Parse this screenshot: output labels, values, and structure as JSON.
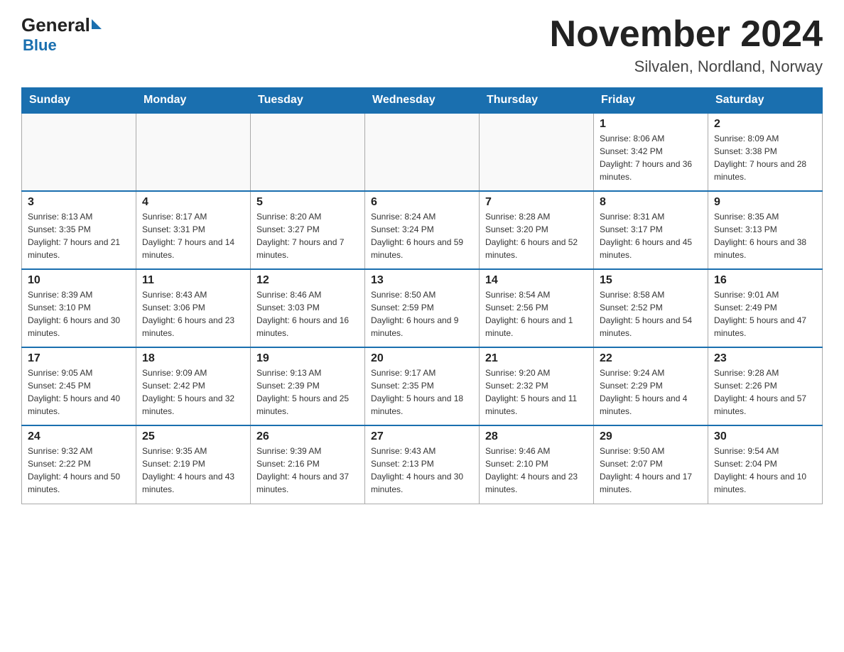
{
  "header": {
    "logo_general": "General",
    "logo_blue": "Blue",
    "month_title": "November 2024",
    "location": "Silvalen, Nordland, Norway"
  },
  "weekdays": [
    "Sunday",
    "Monday",
    "Tuesday",
    "Wednesday",
    "Thursday",
    "Friday",
    "Saturday"
  ],
  "weeks": [
    [
      {
        "day": "",
        "info": ""
      },
      {
        "day": "",
        "info": ""
      },
      {
        "day": "",
        "info": ""
      },
      {
        "day": "",
        "info": ""
      },
      {
        "day": "",
        "info": ""
      },
      {
        "day": "1",
        "info": "Sunrise: 8:06 AM\nSunset: 3:42 PM\nDaylight: 7 hours and 36 minutes."
      },
      {
        "day": "2",
        "info": "Sunrise: 8:09 AM\nSunset: 3:38 PM\nDaylight: 7 hours and 28 minutes."
      }
    ],
    [
      {
        "day": "3",
        "info": "Sunrise: 8:13 AM\nSunset: 3:35 PM\nDaylight: 7 hours and 21 minutes."
      },
      {
        "day": "4",
        "info": "Sunrise: 8:17 AM\nSunset: 3:31 PM\nDaylight: 7 hours and 14 minutes."
      },
      {
        "day": "5",
        "info": "Sunrise: 8:20 AM\nSunset: 3:27 PM\nDaylight: 7 hours and 7 minutes."
      },
      {
        "day": "6",
        "info": "Sunrise: 8:24 AM\nSunset: 3:24 PM\nDaylight: 6 hours and 59 minutes."
      },
      {
        "day": "7",
        "info": "Sunrise: 8:28 AM\nSunset: 3:20 PM\nDaylight: 6 hours and 52 minutes."
      },
      {
        "day": "8",
        "info": "Sunrise: 8:31 AM\nSunset: 3:17 PM\nDaylight: 6 hours and 45 minutes."
      },
      {
        "day": "9",
        "info": "Sunrise: 8:35 AM\nSunset: 3:13 PM\nDaylight: 6 hours and 38 minutes."
      }
    ],
    [
      {
        "day": "10",
        "info": "Sunrise: 8:39 AM\nSunset: 3:10 PM\nDaylight: 6 hours and 30 minutes."
      },
      {
        "day": "11",
        "info": "Sunrise: 8:43 AM\nSunset: 3:06 PM\nDaylight: 6 hours and 23 minutes."
      },
      {
        "day": "12",
        "info": "Sunrise: 8:46 AM\nSunset: 3:03 PM\nDaylight: 6 hours and 16 minutes."
      },
      {
        "day": "13",
        "info": "Sunrise: 8:50 AM\nSunset: 2:59 PM\nDaylight: 6 hours and 9 minutes."
      },
      {
        "day": "14",
        "info": "Sunrise: 8:54 AM\nSunset: 2:56 PM\nDaylight: 6 hours and 1 minute."
      },
      {
        "day": "15",
        "info": "Sunrise: 8:58 AM\nSunset: 2:52 PM\nDaylight: 5 hours and 54 minutes."
      },
      {
        "day": "16",
        "info": "Sunrise: 9:01 AM\nSunset: 2:49 PM\nDaylight: 5 hours and 47 minutes."
      }
    ],
    [
      {
        "day": "17",
        "info": "Sunrise: 9:05 AM\nSunset: 2:45 PM\nDaylight: 5 hours and 40 minutes."
      },
      {
        "day": "18",
        "info": "Sunrise: 9:09 AM\nSunset: 2:42 PM\nDaylight: 5 hours and 32 minutes."
      },
      {
        "day": "19",
        "info": "Sunrise: 9:13 AM\nSunset: 2:39 PM\nDaylight: 5 hours and 25 minutes."
      },
      {
        "day": "20",
        "info": "Sunrise: 9:17 AM\nSunset: 2:35 PM\nDaylight: 5 hours and 18 minutes."
      },
      {
        "day": "21",
        "info": "Sunrise: 9:20 AM\nSunset: 2:32 PM\nDaylight: 5 hours and 11 minutes."
      },
      {
        "day": "22",
        "info": "Sunrise: 9:24 AM\nSunset: 2:29 PM\nDaylight: 5 hours and 4 minutes."
      },
      {
        "day": "23",
        "info": "Sunrise: 9:28 AM\nSunset: 2:26 PM\nDaylight: 4 hours and 57 minutes."
      }
    ],
    [
      {
        "day": "24",
        "info": "Sunrise: 9:32 AM\nSunset: 2:22 PM\nDaylight: 4 hours and 50 minutes."
      },
      {
        "day": "25",
        "info": "Sunrise: 9:35 AM\nSunset: 2:19 PM\nDaylight: 4 hours and 43 minutes."
      },
      {
        "day": "26",
        "info": "Sunrise: 9:39 AM\nSunset: 2:16 PM\nDaylight: 4 hours and 37 minutes."
      },
      {
        "day": "27",
        "info": "Sunrise: 9:43 AM\nSunset: 2:13 PM\nDaylight: 4 hours and 30 minutes."
      },
      {
        "day": "28",
        "info": "Sunrise: 9:46 AM\nSunset: 2:10 PM\nDaylight: 4 hours and 23 minutes."
      },
      {
        "day": "29",
        "info": "Sunrise: 9:50 AM\nSunset: 2:07 PM\nDaylight: 4 hours and 17 minutes."
      },
      {
        "day": "30",
        "info": "Sunrise: 9:54 AM\nSunset: 2:04 PM\nDaylight: 4 hours and 10 minutes."
      }
    ]
  ]
}
